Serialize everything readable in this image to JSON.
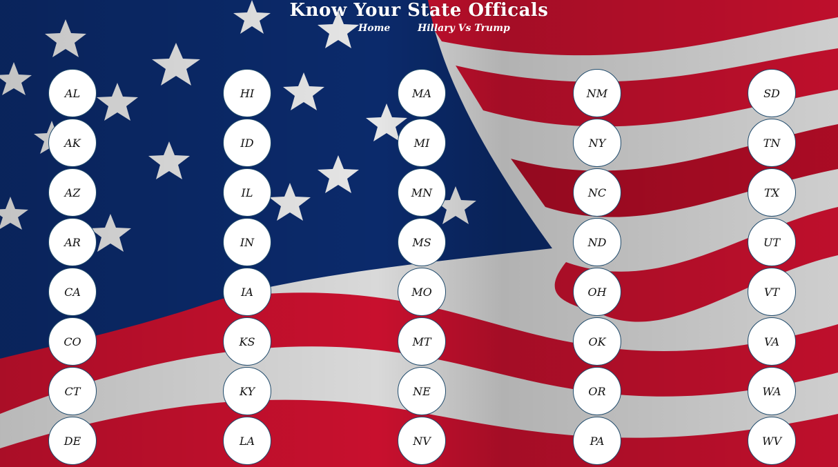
{
  "header": {
    "title": "Know Your State Officals",
    "nav": [
      {
        "label": "Home"
      },
      {
        "label": "Hillary Vs Trump"
      }
    ]
  },
  "states": {
    "columns": [
      [
        "AL",
        "AK",
        "AZ",
        "AR",
        "CA",
        "CO",
        "CT",
        "DE"
      ],
      [
        "HI",
        "ID",
        "IL",
        "IN",
        "IA",
        "KS",
        "KY",
        "LA"
      ],
      [
        "MA",
        "MI",
        "MN",
        "MS",
        "MO",
        "MT",
        "NE",
        "NV"
      ],
      [
        "NM",
        "NY",
        "NC",
        "ND",
        "OH",
        "OK",
        "OR",
        "PA"
      ],
      [
        "SD",
        "TN",
        "TX",
        "UT",
        "VT",
        "VA",
        "WA",
        "WV"
      ]
    ]
  },
  "colors": {
    "flag_red": "#c8102e",
    "flag_white": "#ffffff",
    "flag_blue": "#0b2a6b",
    "circle_border": "#1f4a6b"
  }
}
